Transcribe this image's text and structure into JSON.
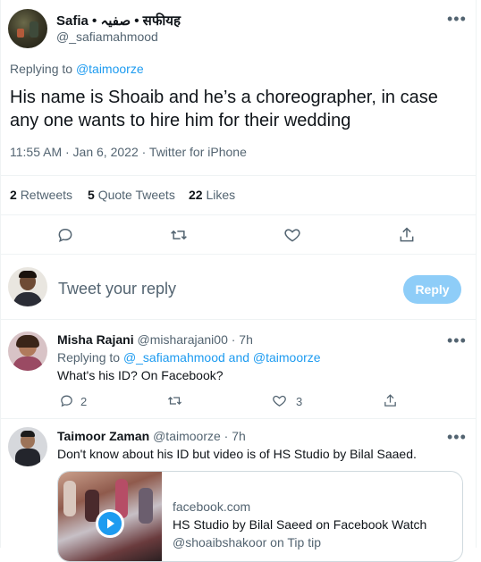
{
  "main_tweet": {
    "author_name": "Safia • صفیہ • सफीयह",
    "author_handle": "@_safiamahmood",
    "replying_prefix": "Replying to",
    "replying_to": "@taimoorze",
    "text": "His name is Shoaib and he’s a choreographer, in case any one wants to hire him for their wedding",
    "meta": "11:55 AM · Jan 6, 2022 · Twitter for iPhone",
    "stats": {
      "retweets_count": "2",
      "retweets_label": "Retweets",
      "quotes_count": "5",
      "quotes_label": "Quote Tweets",
      "likes_count": "22",
      "likes_label": "Likes"
    }
  },
  "composer": {
    "placeholder": "Tweet your reply",
    "reply_button": "Reply"
  },
  "replies": [
    {
      "name": "Misha Rajani",
      "handle": "@misharajani00",
      "time": "· 7h",
      "replying_prefix": "Replying to",
      "replying_to": "@_safiamahmood and @taimoorze",
      "text": "What's his ID? On Facebook?",
      "reply_count": "2",
      "like_count": "3"
    },
    {
      "name": "Taimoor Zaman",
      "handle": "@taimoorze",
      "time": "· 7h",
      "text": "Don't know about his ID but video is of HS Studio by Bilal Saaed.",
      "card": {
        "domain": "facebook.com",
        "title": "HS Studio by Bilal Saeed on Facebook Watch",
        "subtitle": "@shoaibshakoor on Tip tip"
      }
    }
  ],
  "colors": {
    "accent": "#1d9bf0",
    "reply_button_bg": "#8ecdf8",
    "muted_text": "#536471"
  },
  "icons": [
    "more-icon",
    "reply-icon",
    "retweet-icon",
    "like-icon",
    "share-icon",
    "play-icon"
  ]
}
